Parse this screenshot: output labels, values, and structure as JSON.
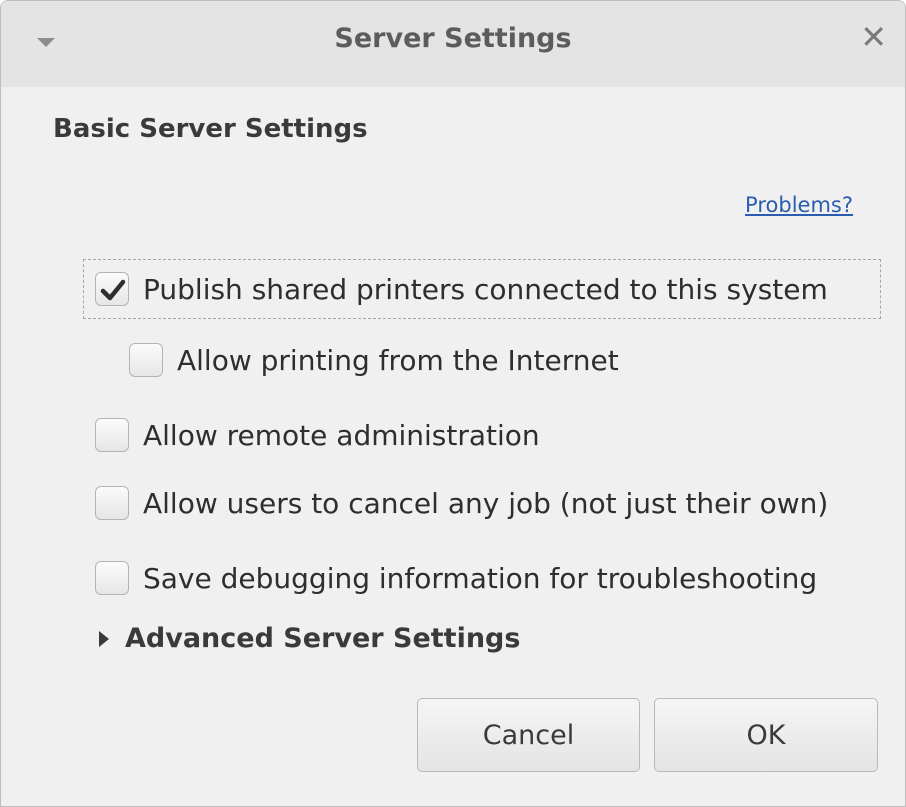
{
  "window": {
    "title": "Server Settings",
    "menu_icon": "chevron-down-icon",
    "close_icon": "close-icon",
    "close_glyph": "✕"
  },
  "main": {
    "section_title": "Basic Server Settings",
    "problems_link": "Problems?",
    "options": [
      {
        "label": "Publish shared printers connected to this system",
        "checked": true
      },
      {
        "label": "Allow printing from the Internet",
        "checked": false
      },
      {
        "label": "Allow remote administration",
        "checked": false
      },
      {
        "label": "Allow users to cancel any job (not just their own)",
        "checked": false
      },
      {
        "label": "Save debugging information for troubleshooting",
        "checked": false
      }
    ],
    "advanced_label": "Advanced Server Settings"
  },
  "buttons": {
    "cancel": "Cancel",
    "ok": "OK"
  },
  "colors": {
    "link": "#2a5db0",
    "background": "#f0f0f0"
  }
}
